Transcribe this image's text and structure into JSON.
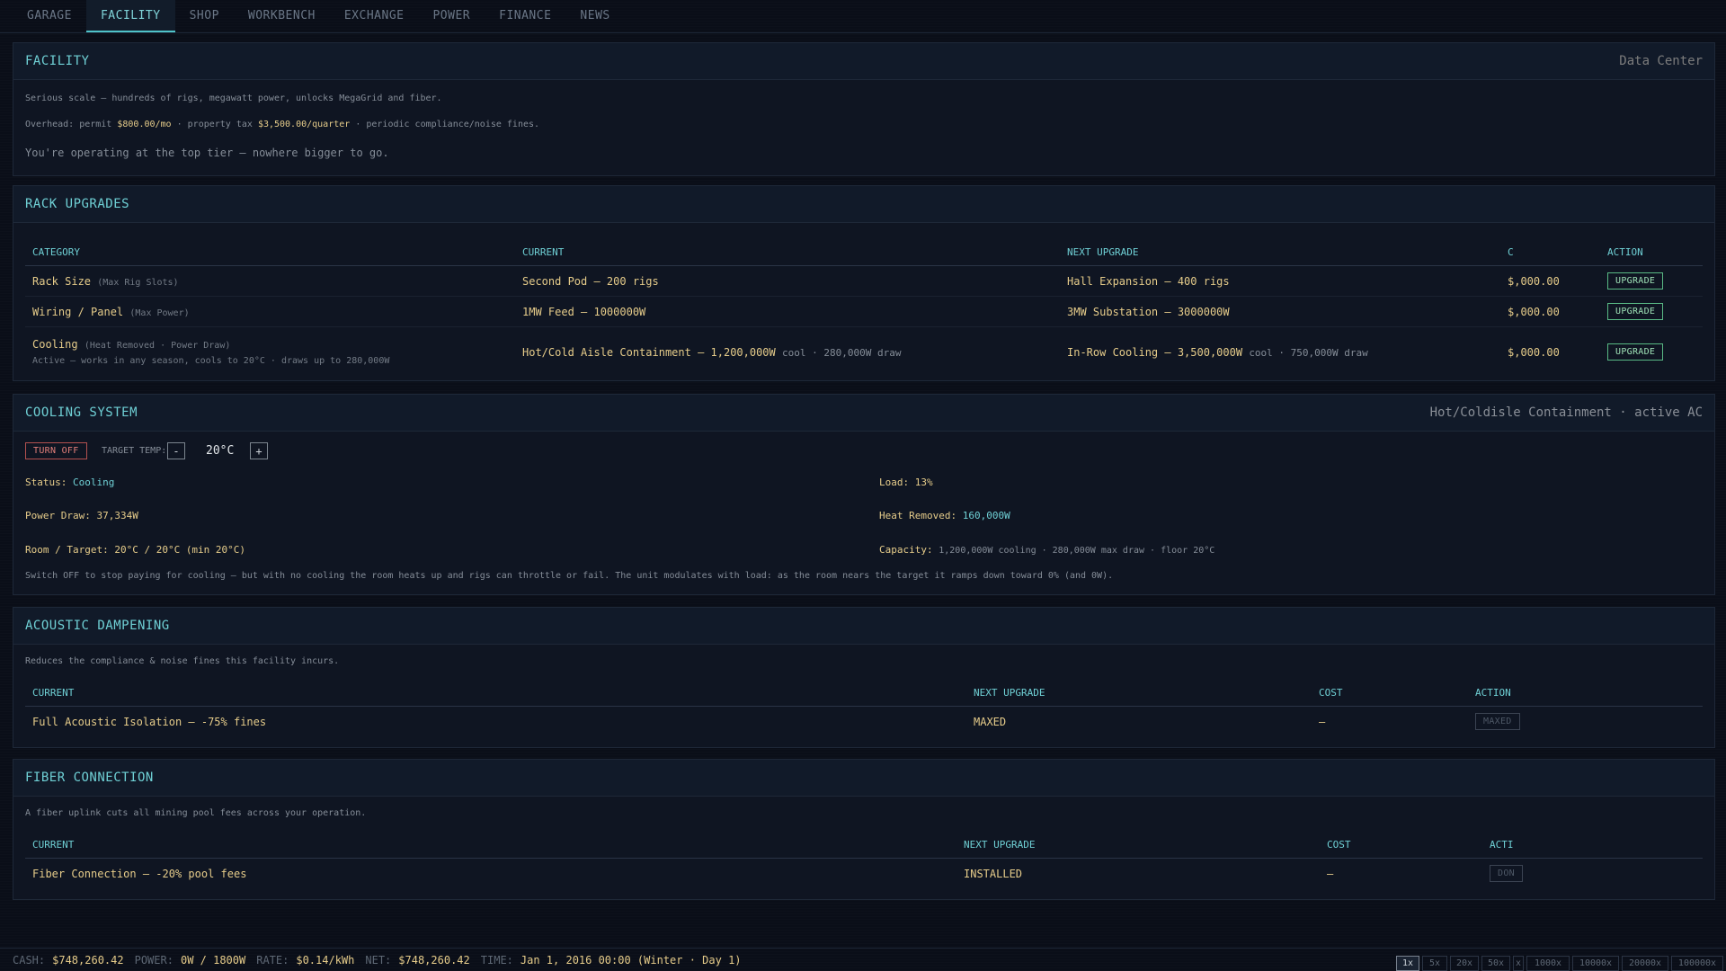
{
  "tabs": [
    {
      "label": "GARAGE",
      "active": false
    },
    {
      "label": "FACILITY",
      "active": true
    },
    {
      "label": "SHOP",
      "active": false
    },
    {
      "label": "WORKBENCH",
      "active": false
    },
    {
      "label": "EXCHANGE",
      "active": false
    },
    {
      "label": "POWER",
      "active": false
    },
    {
      "label": "FINANCE",
      "active": false
    },
    {
      "label": "NEWS",
      "active": false
    }
  ],
  "facility": {
    "title": "FACILITY",
    "tier": "Data Center",
    "description": "Serious scale — hundreds of rigs, megawatt power, unlocks MegaGrid and fiber.",
    "overhead_prefix": "Overhead: permit",
    "permit": "$800.00/mo",
    "tax_label": "· property tax",
    "tax": "$3,500.00/quarter",
    "overhead_suffix": "· periodic compliance/noise fines.",
    "top_tier_msg": "You're operating at the top tier — nowhere bigger to go."
  },
  "rack": {
    "title": "RACK UPGRADES",
    "columns": [
      "CATEGORY",
      "CURRENT",
      "NEXT UPGRADE",
      "C",
      "ACTION"
    ],
    "rows": [
      {
        "category": "Rack Size",
        "category_sub": "(Max Rig Slots)",
        "note": "",
        "current": "Second Pod — 200 rigs",
        "current_extra": "",
        "next": "Hall Expansion — 400 rigs",
        "next_extra": "",
        "cost": "$,000.00",
        "action": "UPGRADE"
      },
      {
        "category": "Wiring / Panel",
        "category_sub": "(Max Power)",
        "note": "",
        "current": "1MW Feed — 1000000W",
        "current_extra": "",
        "next": "3MW Substation — 3000000W",
        "next_extra": "",
        "cost": "$,000.00",
        "action": "UPGRADE"
      },
      {
        "category": "Cooling",
        "category_sub": "(Heat Removed · Power Draw)",
        "note": "Active — works in any season, cools to 20°C · draws up to 280,000W",
        "current": "Hot/Cold Aisle Containment — 1,200,000W",
        "current_extra": "cool · 280,000W draw",
        "next": "In-Row Cooling — 3,500,000W",
        "next_extra": "cool · 750,000W draw",
        "cost": "$,000.00",
        "action": "UPGRADE"
      }
    ]
  },
  "cooling": {
    "title": "COOLING SYSTEM",
    "right": "Hot/Coldisle Containment · active AC",
    "turn_off": "TURN OFF",
    "target_label": "TARGET TEMP:",
    "minus": "-",
    "temp": "20°C",
    "plus": "+",
    "status_label": "Status:",
    "status_value": "Cooling",
    "load_label": "Load:",
    "load_value": "13%",
    "power_label": "Power Draw:",
    "power_value": "37,334W",
    "heat_label": "Heat Removed:",
    "heat_value": "160,000W",
    "room_label": "Room / Target:",
    "room_value": "20°C / 20°C (min 20°C)",
    "capacity_label": "Capacity:",
    "capacity_value": "1,200,000W cooling · 280,000W max draw · floor 20°C",
    "note": "Switch OFF to stop paying for cooling — but with no cooling the room heats up and rigs can throttle or fail. The unit modulates with load: as the room nears the target it ramps down toward 0% (and 0W)."
  },
  "acoustic": {
    "title": "ACOUSTIC DAMPENING",
    "description": "Reduces the compliance & noise fines this facility incurs.",
    "columns": [
      "CURRENT",
      "NEXT UPGRADE",
      "COST",
      "ACTION"
    ],
    "current": "Full Acoustic Isolation — -75% fines",
    "next": "MAXED",
    "cost": "—",
    "action": "MAXED"
  },
  "fiber": {
    "title": "FIBER CONNECTION",
    "description": "A fiber uplink cuts all mining pool fees across your operation.",
    "columns": [
      "CURRENT",
      "NEXT UPGRADE",
      "COST",
      "ACTI"
    ],
    "current": "Fiber Connection — -20% pool fees",
    "next": "INSTALLED",
    "cost": "—",
    "action": "DON"
  },
  "statusbar": {
    "cash_label": "CASH:",
    "cash": "$748,260.42",
    "power_label": "POWER:",
    "power": "0W / 1800W",
    "rate_label": "RATE:",
    "rate": "$0.14/kWh",
    "net_label": "NET:",
    "net": "$748,260.42",
    "time_label": "TIME:",
    "time": "Jan 1, 2016 00:00 (Winter · Day 1)"
  },
  "speeds": [
    {
      "label": "1x",
      "active": true
    },
    {
      "label": "5x",
      "active": false
    },
    {
      "label": "20x",
      "active": false
    },
    {
      "label": "50x",
      "active": false
    },
    {
      "label": "x",
      "active": false
    },
    {
      "label": "1000x",
      "active": false
    },
    {
      "label": "10000x",
      "active": false
    },
    {
      "label": "20000x",
      "active": false
    },
    {
      "label": "100000x",
      "active": false
    }
  ],
  "colors": {
    "accent": "#6fd0d5",
    "gold": "#e6cc8a",
    "green": "#59b985",
    "red": "#b3514f",
    "bg": "#0a0e18"
  }
}
